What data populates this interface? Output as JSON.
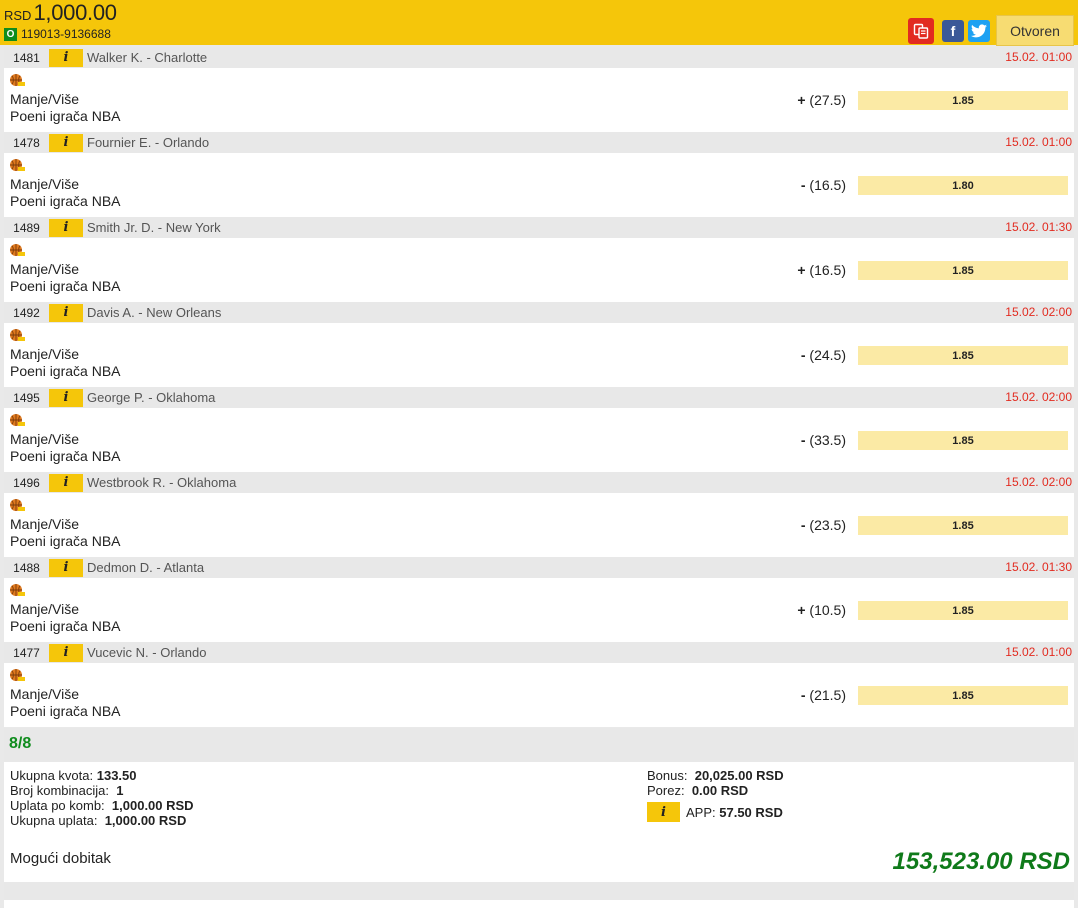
{
  "header": {
    "currency": "RSD",
    "amount": "1,000.00",
    "status_letter": "O",
    "ticket_id": "119013-9136688",
    "facebook_label": "f",
    "status_button": "Otvoren",
    "colors": {
      "bar": "#f5c60a",
      "copy": "#e22b20",
      "facebook": "#3b5998",
      "twitter": "#1da1f2"
    }
  },
  "events": [
    {
      "code": "1481",
      "match": "Walker K. - Charlotte",
      "time": "15.02. 01:00",
      "market": "Manje/Više",
      "league": "Poeni igrača NBA",
      "sign": "+",
      "line": "(27.5)",
      "odds": "1.85",
      "sport_icon": "basketball-icon"
    },
    {
      "code": "1478",
      "match": "Fournier E. - Orlando",
      "time": "15.02. 01:00",
      "market": "Manje/Više",
      "league": "Poeni igrača NBA",
      "sign": "-",
      "line": "(16.5)",
      "odds": "1.80",
      "sport_icon": "basketball-icon"
    },
    {
      "code": "1489",
      "match": "Smith Jr. D. - New York",
      "time": "15.02. 01:30",
      "market": "Manje/Više",
      "league": "Poeni igrača NBA",
      "sign": "+",
      "line": "(16.5)",
      "odds": "1.85",
      "sport_icon": "basketball-icon"
    },
    {
      "code": "1492",
      "match": "Davis A. - New Orleans",
      "time": "15.02. 02:00",
      "market": "Manje/Više",
      "league": "Poeni igrača NBA",
      "sign": "-",
      "line": "(24.5)",
      "odds": "1.85",
      "sport_icon": "basketball-icon"
    },
    {
      "code": "1495",
      "match": "George P. - Oklahoma",
      "time": "15.02. 02:00",
      "market": "Manje/Više",
      "league": "Poeni igrača NBA",
      "sign": "-",
      "line": "(33.5)",
      "odds": "1.85",
      "sport_icon": "basketball-icon"
    },
    {
      "code": "1496",
      "match": "Westbrook R. - Oklahoma",
      "time": "15.02. 02:00",
      "market": "Manje/Više",
      "league": "Poeni igrača NBA",
      "sign": "-",
      "line": "(23.5)",
      "odds": "1.85",
      "sport_icon": "basketball-icon"
    },
    {
      "code": "1488",
      "match": "Dedmon D. - Atlanta",
      "time": "15.02. 01:30",
      "market": "Manje/Više",
      "league": "Poeni igrača NBA",
      "sign": "+",
      "line": "(10.5)",
      "odds": "1.85",
      "sport_icon": "basketball-icon"
    },
    {
      "code": "1477",
      "match": "Vucevic N. - Orlando",
      "time": "15.02. 01:00",
      "market": "Manje/Više",
      "league": "Poeni igrača NBA",
      "sign": "-",
      "line": "(21.5)",
      "odds": "1.85",
      "sport_icon": "basketball-icon"
    }
  ],
  "info_icon_label": "i",
  "count": "8/8",
  "summary": {
    "total_odds_label": "Ukupna kvota:",
    "total_odds": "133.50",
    "combinations_label": "Broj kombinacija:",
    "combinations": "1",
    "stake_per_comb_label": "Uplata po komb:",
    "stake_per_comb": "1,000.00 RSD",
    "total_stake_label": "Ukupna uplata:",
    "total_stake": "1,000.00 RSD",
    "bonus_label": "Bonus:",
    "bonus": "20,025.00 RSD",
    "tax_label": "Porez:",
    "tax": "0.00 RSD",
    "app_label": "APP:",
    "app": "57.50 RSD",
    "possible_win_label": "Mogući dobitak",
    "possible_win": "153,523.00 RSD"
  }
}
